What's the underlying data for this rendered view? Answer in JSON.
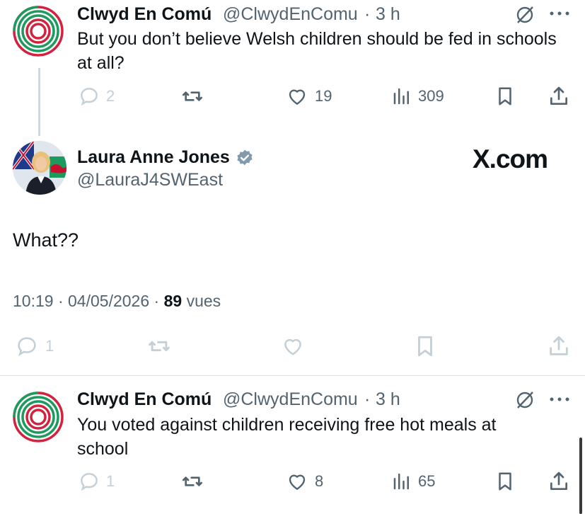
{
  "tweet1": {
    "display_name": "Clwyd En Comú",
    "handle": "@ClwydEnComu",
    "separator": "·",
    "time": "3 h",
    "text": "But you don’t believe Welsh children should be fed in schools at all?",
    "replies": "2",
    "likes": "19",
    "views": "309"
  },
  "main_tweet": {
    "display_name": "Laura Anne Jones",
    "handle": "@LauraJ4SWEast",
    "brand": "X.com",
    "text": "What??",
    "time": "10:19",
    "sep1": "·",
    "date": "04/05/2026",
    "sep2": "·",
    "views_count": "89",
    "views_label": "vues",
    "replies": "1"
  },
  "tweet2": {
    "display_name": "Clwyd En Comú",
    "handle": "@ClwydEnComu",
    "separator": "·",
    "time": "3 h",
    "text": "You voted against children receiving free hot meals at school",
    "replies": "1",
    "likes": "8",
    "views": "65"
  },
  "colors": {
    "text": "#0f1419",
    "secondary": "#536471",
    "faded": "#c4cfd6",
    "logo_green": "#1d9b5e",
    "logo_red": "#d4213d",
    "verified": "#829aab"
  }
}
